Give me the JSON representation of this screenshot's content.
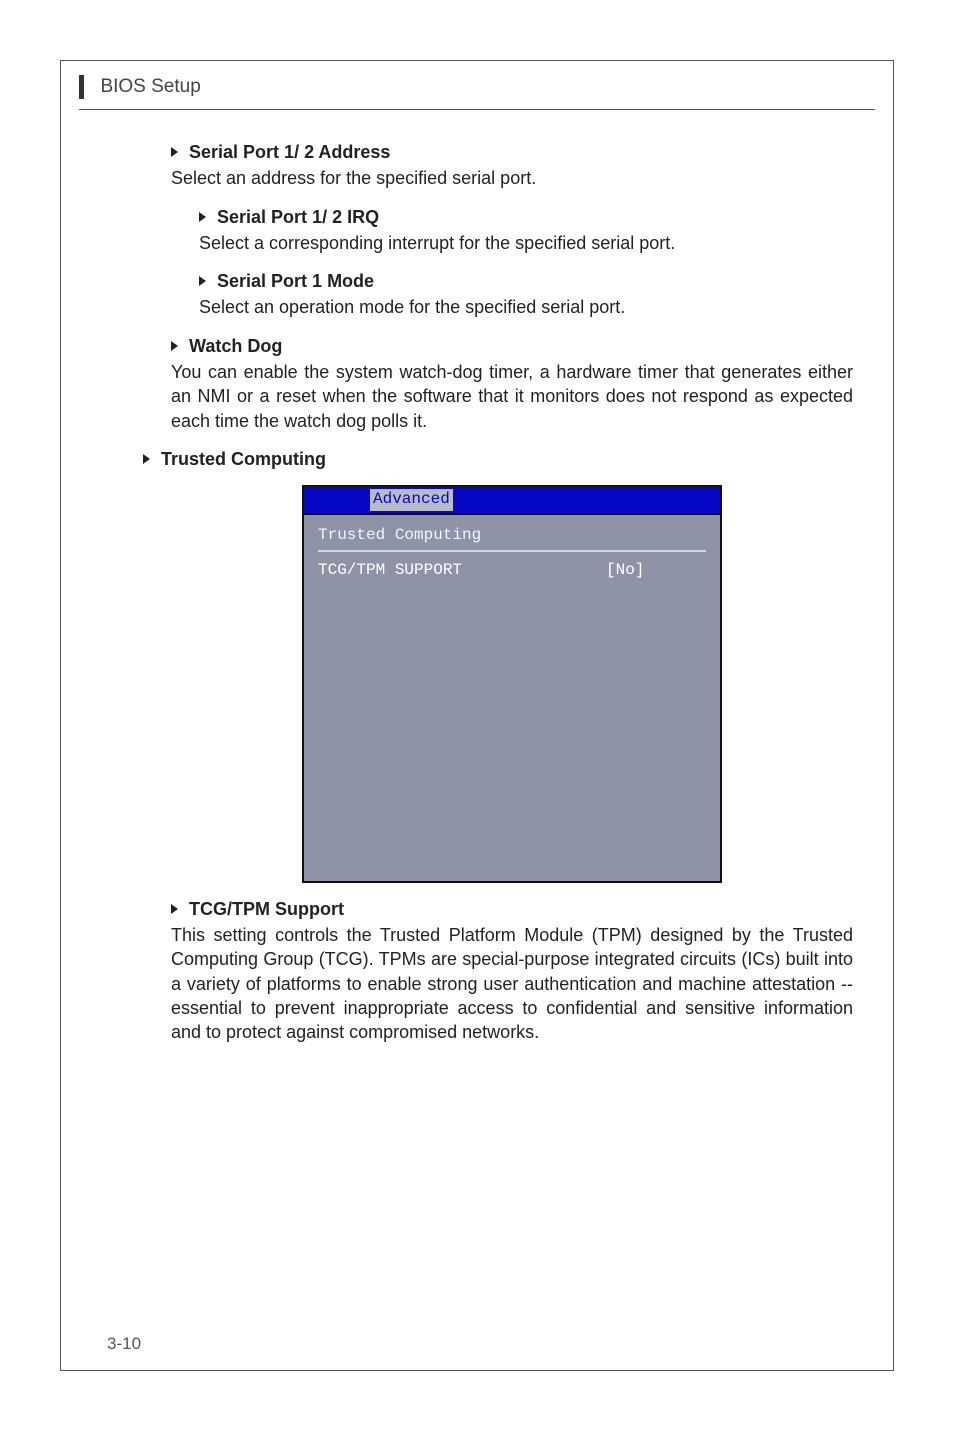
{
  "header": {
    "title": "BIOS Setup"
  },
  "sections": {
    "sp_addr": {
      "title": "Serial Port 1/ 2 Address",
      "body": "Select an address for the specified serial port."
    },
    "sp_irq": {
      "title": "Serial Port 1/ 2 IRQ",
      "body": "Select a corresponding interrupt for the specified serial port."
    },
    "sp_mode": {
      "title": "Serial Port 1 Mode",
      "body": "Select an operation mode for the specified serial port."
    },
    "watch_dog": {
      "title": "Watch Dog",
      "body": "You can enable the system watch-dog timer, a hardware timer that generates either an NMI or a reset when the software that it monitors does not respond as expected each time the watch dog polls it."
    },
    "trusted_computing": {
      "title": "Trusted Computing"
    },
    "tcg_tpm": {
      "title": "TCG/TPM Support",
      "body": "This setting controls the Trusted Platform Module (TPM) designed by the Trusted Computing Group (TCG). TPMs are special-purpose integrated circuits (ICs) built into a variety of platforms to enable strong user authentication and machine attestation -- essential to prevent inappropriate access to confidential and sensitive information and to protect against compromised networks."
    }
  },
  "bios": {
    "tab": "Advanced",
    "panel_title": "Trusted Computing",
    "row_label": "TCG/TPM SUPPORT",
    "row_value": "[No]"
  },
  "footer": {
    "page_number": "3-10"
  }
}
